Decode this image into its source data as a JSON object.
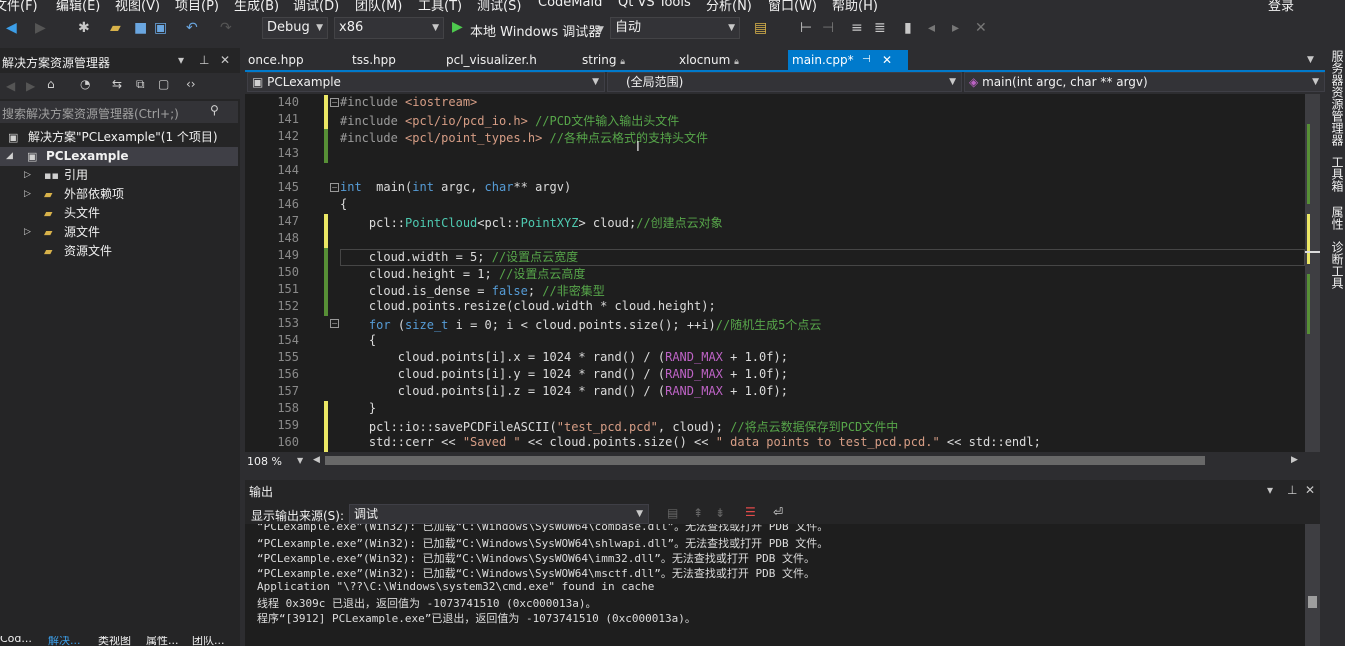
{
  "menu": [
    "文件(F)",
    "编辑(E)",
    "视图(V)",
    "项目(P)",
    "生成(B)",
    "调试(D)",
    "团队(M)",
    "工具(T)",
    "测试(S)",
    "CodeMaid",
    "Qt VS Tools",
    "分析(N)",
    "窗口(W)",
    "帮助(H)"
  ],
  "user": "登录",
  "toolbar": {
    "config": "Debug",
    "platform": "x86",
    "run_label": "本地 Windows 调试器",
    "mode": "自动"
  },
  "solution_explorer": {
    "title": "解决方案资源管理器",
    "search_placeholder": "搜索解决方案资源管理器(Ctrl+;)",
    "solution": "解决方案\"PCLexample\"(1 个项目)",
    "project": "PCLexample",
    "items": [
      "引用",
      "外部依赖项",
      "头文件",
      "源文件",
      "资源文件"
    ],
    "bottom_tabs": [
      "Cod...",
      "解决...",
      "类视图",
      "属性...",
      "团队..."
    ]
  },
  "tabs": [
    {
      "label": "once.hpp",
      "pinned": false
    },
    {
      "label": "tss.hpp",
      "pinned": false
    },
    {
      "label": "pcl_visualizer.h",
      "pinned": false
    },
    {
      "label": "string",
      "pinned": true
    },
    {
      "label": "xlocnum",
      "pinned": true
    },
    {
      "label": "main.cpp*",
      "pinned": false,
      "active": true
    }
  ],
  "nav": {
    "project": "PCLexample",
    "scope": "(全局范围)",
    "member": "main(int argc, char ** argv)"
  },
  "zoom": "108 %",
  "line_numbers": [
    "140",
    "141",
    "142",
    "143",
    "144",
    "145",
    "146",
    "147",
    "148",
    "149",
    "150",
    "151",
    "152",
    "153",
    "154",
    "155",
    "156",
    "157",
    "158",
    "159",
    "160"
  ],
  "code": {
    "c140_a": "#include ",
    "c140_b": "<iostream>",
    "c141_a": "#include ",
    "c141_b": "<pcl/io/pcd_io.h>",
    "c141_c": " //PCD文件输入输出头文件",
    "c142_a": "#include ",
    "c142_b": "<pcl/point_types.h>",
    "c142_c": " //各种点云格式的支持头文件",
    "c145_a": "int",
    "c145_b": "  main(",
    "c145_c": "int",
    "c145_d": " argc, ",
    "c145_e": "char",
    "c145_f": "** argv)",
    "c146": "{",
    "c147_a": "    pcl::",
    "c147_b": "PointCloud",
    "c147_c": "<pcl::",
    "c147_d": "PointXYZ",
    "c147_e": "> cloud;",
    "c147_f": "//创建点云对象",
    "c149_a": "    cloud.width = 5; ",
    "c149_b": "//设置点云宽度",
    "c150_a": "    cloud.height = 1; ",
    "c150_b": "//设置点云高度",
    "c151_a": "    cloud.is_dense = ",
    "c151_b": "false",
    "c151_c": "; ",
    "c151_d": "//非密集型",
    "c152": "    cloud.points.resize(cloud.width * cloud.height);",
    "c153_a": "    ",
    "c153_b": "for",
    "c153_c": " (",
    "c153_d": "size_t",
    "c153_e": " i = 0; i < cloud.points.size(); ++i)",
    "c153_f": "//随机生成5个点云",
    "c154": "    {",
    "c155_a": "        cloud.points[i].x = 1024 * rand() / (",
    "c155_b": "RAND_MAX",
    "c155_c": " + 1.0f);",
    "c156_a": "        cloud.points[i].y = 1024 * rand() / (",
    "c156_b": "RAND_MAX",
    "c156_c": " + 1.0f);",
    "c157_a": "        cloud.points[i].z = 1024 * rand() / (",
    "c157_b": "RAND_MAX",
    "c157_c": " + 1.0f);",
    "c158": "    }",
    "c159_a": "    pcl::io::savePCDFileASCII(",
    "c159_b": "\"test_pcd.pcd\"",
    "c159_c": ", cloud); ",
    "c159_d": "//将点云数据保存到PCD文件中",
    "c160_a": "    std::cerr << ",
    "c160_b": "\"Saved \"",
    "c160_c": " << cloud.points.size() << ",
    "c160_d": "\" data points to test_pcd.pcd.\"",
    "c160_e": " << std::endl;"
  },
  "output": {
    "title": "输出",
    "source_label": "显示输出来源(S):",
    "source_value": "调试",
    "lines": [
      "“PCLexample.exe”(Win32): 已加载“C:\\Windows\\SysWOW64\\combase.dll”。无法查找或打开 PDB 文件。",
      "“PCLexample.exe”(Win32): 已加载“C:\\Windows\\SysWOW64\\shlwapi.dll”。无法查找或打开 PDB 文件。",
      "“PCLexample.exe”(Win32): 已加载“C:\\Windows\\SysWOW64\\imm32.dll”。无法查找或打开 PDB 文件。",
      "“PCLexample.exe”(Win32): 已加载“C:\\Windows\\SysWOW64\\msctf.dll”。无法查找或打开 PDB 文件。",
      "Application \"\\??\\C:\\Windows\\system32\\cmd.exe\" found in cache",
      "线程 0x309c 已退出，返回值为 -1073741510 (0xc000013a)。",
      "程序“[3912] PCLexample.exe”已退出，返回值为 -1073741510 (0xc000013a)。"
    ]
  },
  "right_dock": [
    "服务器资源管理器",
    "工具箱",
    "属性",
    "诊断工具"
  ],
  "colors": {
    "accent": "#007acc",
    "keyword": "#569cd6",
    "comment": "#57a64a",
    "string": "#d69d85",
    "type": "#4ec9b0",
    "macro": "#bd63c5"
  }
}
